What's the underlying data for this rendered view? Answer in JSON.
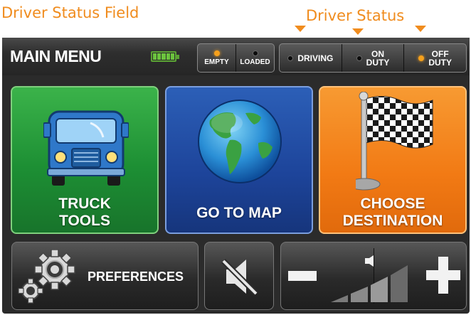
{
  "annotations": {
    "driver_status_field": "Driver Status Field",
    "driver_status": "Driver Status"
  },
  "header": {
    "title": "MAIN MENU",
    "battery_icon": "battery-full-icon",
    "load_toggle": [
      {
        "label": "EMPTY",
        "active": true
      },
      {
        "label": "LOADED",
        "active": false
      }
    ],
    "driver_status": [
      {
        "label": "DRIVING",
        "active": false
      },
      {
        "label": "ON DUTY",
        "line1": "ON",
        "line2": "DUTY",
        "active": false
      },
      {
        "label": "OFF DUTY",
        "line1": "OFF",
        "line2": "DUTY",
        "active": true
      }
    ]
  },
  "tiles": {
    "truck_tools": {
      "line1": "TRUCK",
      "line2": "TOOLS",
      "icon": "truck-icon"
    },
    "go_to_map": {
      "label": "GO TO MAP",
      "icon": "globe-icon"
    },
    "choose_destination": {
      "line1": "CHOOSE",
      "line2": "DESTINATION",
      "icon": "checkered-flag-icon"
    }
  },
  "bottom": {
    "preferences": {
      "label": "PREFERENCES",
      "icon": "gears-icon"
    },
    "mute": {
      "icon": "speaker-muted-icon"
    },
    "volume": {
      "minus": "minus-icon",
      "plus": "plus-icon",
      "level_icon": "volume-level-icon"
    }
  },
  "colors": {
    "accent": "#f08c1e",
    "indicator_on": "#f5a01c",
    "truck_tile": "#2aa33e",
    "map_tile": "#2356ac",
    "dest_tile": "#f58220"
  }
}
